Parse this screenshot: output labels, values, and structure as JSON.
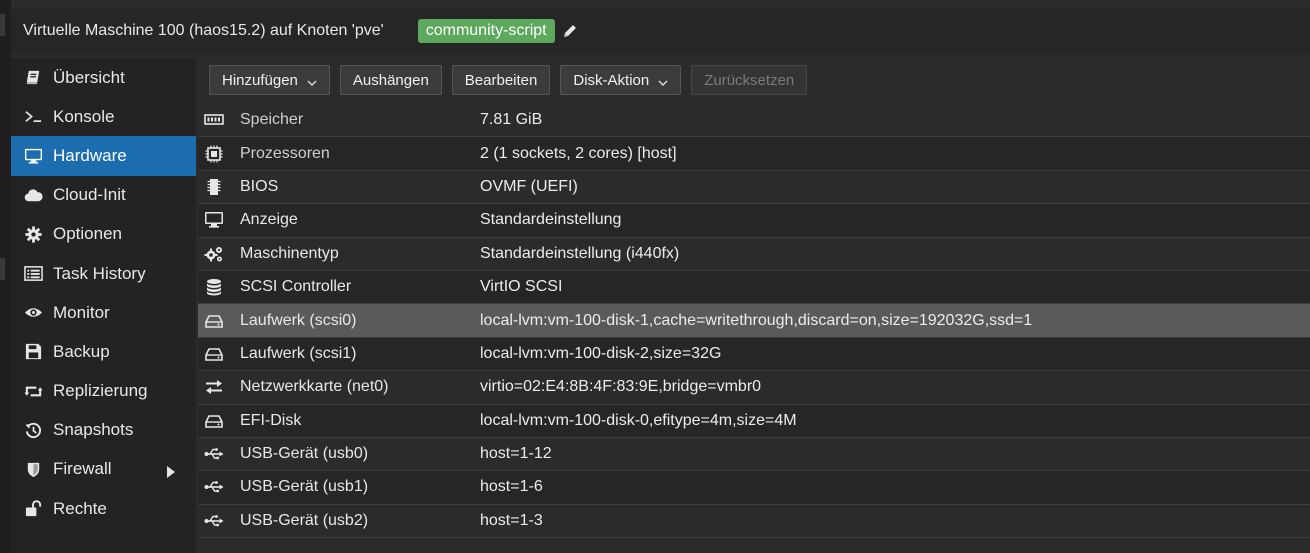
{
  "header": {
    "title": "Virtuelle Maschine 100 (haos15.2) auf Knoten 'pve'",
    "tag": "community-script"
  },
  "sidebar": {
    "items": [
      {
        "label": "Übersicht",
        "icon": "book-icon"
      },
      {
        "label": "Konsole",
        "icon": "terminal-icon"
      },
      {
        "label": "Hardware",
        "icon": "desktop-icon",
        "active": true
      },
      {
        "label": "Cloud-Init",
        "icon": "cloud-icon"
      },
      {
        "label": "Optionen",
        "icon": "gear-icon"
      },
      {
        "label": "Task History",
        "icon": "list-icon"
      },
      {
        "label": "Monitor",
        "icon": "eye-icon"
      },
      {
        "label": "Backup",
        "icon": "floppy-icon"
      },
      {
        "label": "Replizierung",
        "icon": "retweet-icon"
      },
      {
        "label": "Snapshots",
        "icon": "history-icon"
      },
      {
        "label": "Firewall",
        "icon": "shield-icon",
        "has_submenu": true
      },
      {
        "label": "Rechte",
        "icon": "unlock-icon"
      }
    ]
  },
  "toolbar": {
    "add": "Hinzufügen",
    "detach": "Aushängen",
    "edit": "Bearbeiten",
    "disk_action": "Disk-Aktion",
    "revert": "Zurücksetzen"
  },
  "hardware": {
    "rows": [
      {
        "key": "Speicher",
        "value": "7.81 GiB",
        "icon": "memory-icon"
      },
      {
        "key": "Prozessoren",
        "value": "2 (1 sockets, 2 cores) [host]",
        "icon": "cpu-icon"
      },
      {
        "key": "BIOS",
        "value": "OVMF (UEFI)",
        "icon": "microchip-icon"
      },
      {
        "key": "Anzeige",
        "value": "Standardeinstellung",
        "icon": "desktop-icon"
      },
      {
        "key": "Maschinentyp",
        "value": "Standardeinstellung (i440fx)",
        "icon": "cogs-icon"
      },
      {
        "key": "SCSI Controller",
        "value": "VirtIO SCSI",
        "icon": "database-icon"
      },
      {
        "key": "Laufwerk (scsi0)",
        "value": "local-lvm:vm-100-disk-1,cache=writethrough,discard=on,size=192032G,ssd=1",
        "icon": "hdd-icon",
        "selected": true
      },
      {
        "key": "Laufwerk (scsi1)",
        "value": "local-lvm:vm-100-disk-2,size=32G",
        "icon": "hdd-icon"
      },
      {
        "key": "Netzwerkkarte (net0)",
        "value": "virtio=02:E4:8B:4F:83:9E,bridge=vmbr0",
        "icon": "exchange-icon"
      },
      {
        "key": "EFI-Disk",
        "value": "local-lvm:vm-100-disk-0,efitype=4m,size=4M",
        "icon": "hdd-icon"
      },
      {
        "key": "USB-Gerät (usb0)",
        "value": "host=1-12",
        "icon": "usb-icon"
      },
      {
        "key": "USB-Gerät (usb1)",
        "value": "host=1-6",
        "icon": "usb-icon"
      },
      {
        "key": "USB-Gerät (usb2)",
        "value": "host=1-3",
        "icon": "usb-icon"
      }
    ]
  },
  "colors": {
    "accent": "#1b6db0",
    "tag": "#5ca85c",
    "selected_row": "#5a5a5a"
  }
}
